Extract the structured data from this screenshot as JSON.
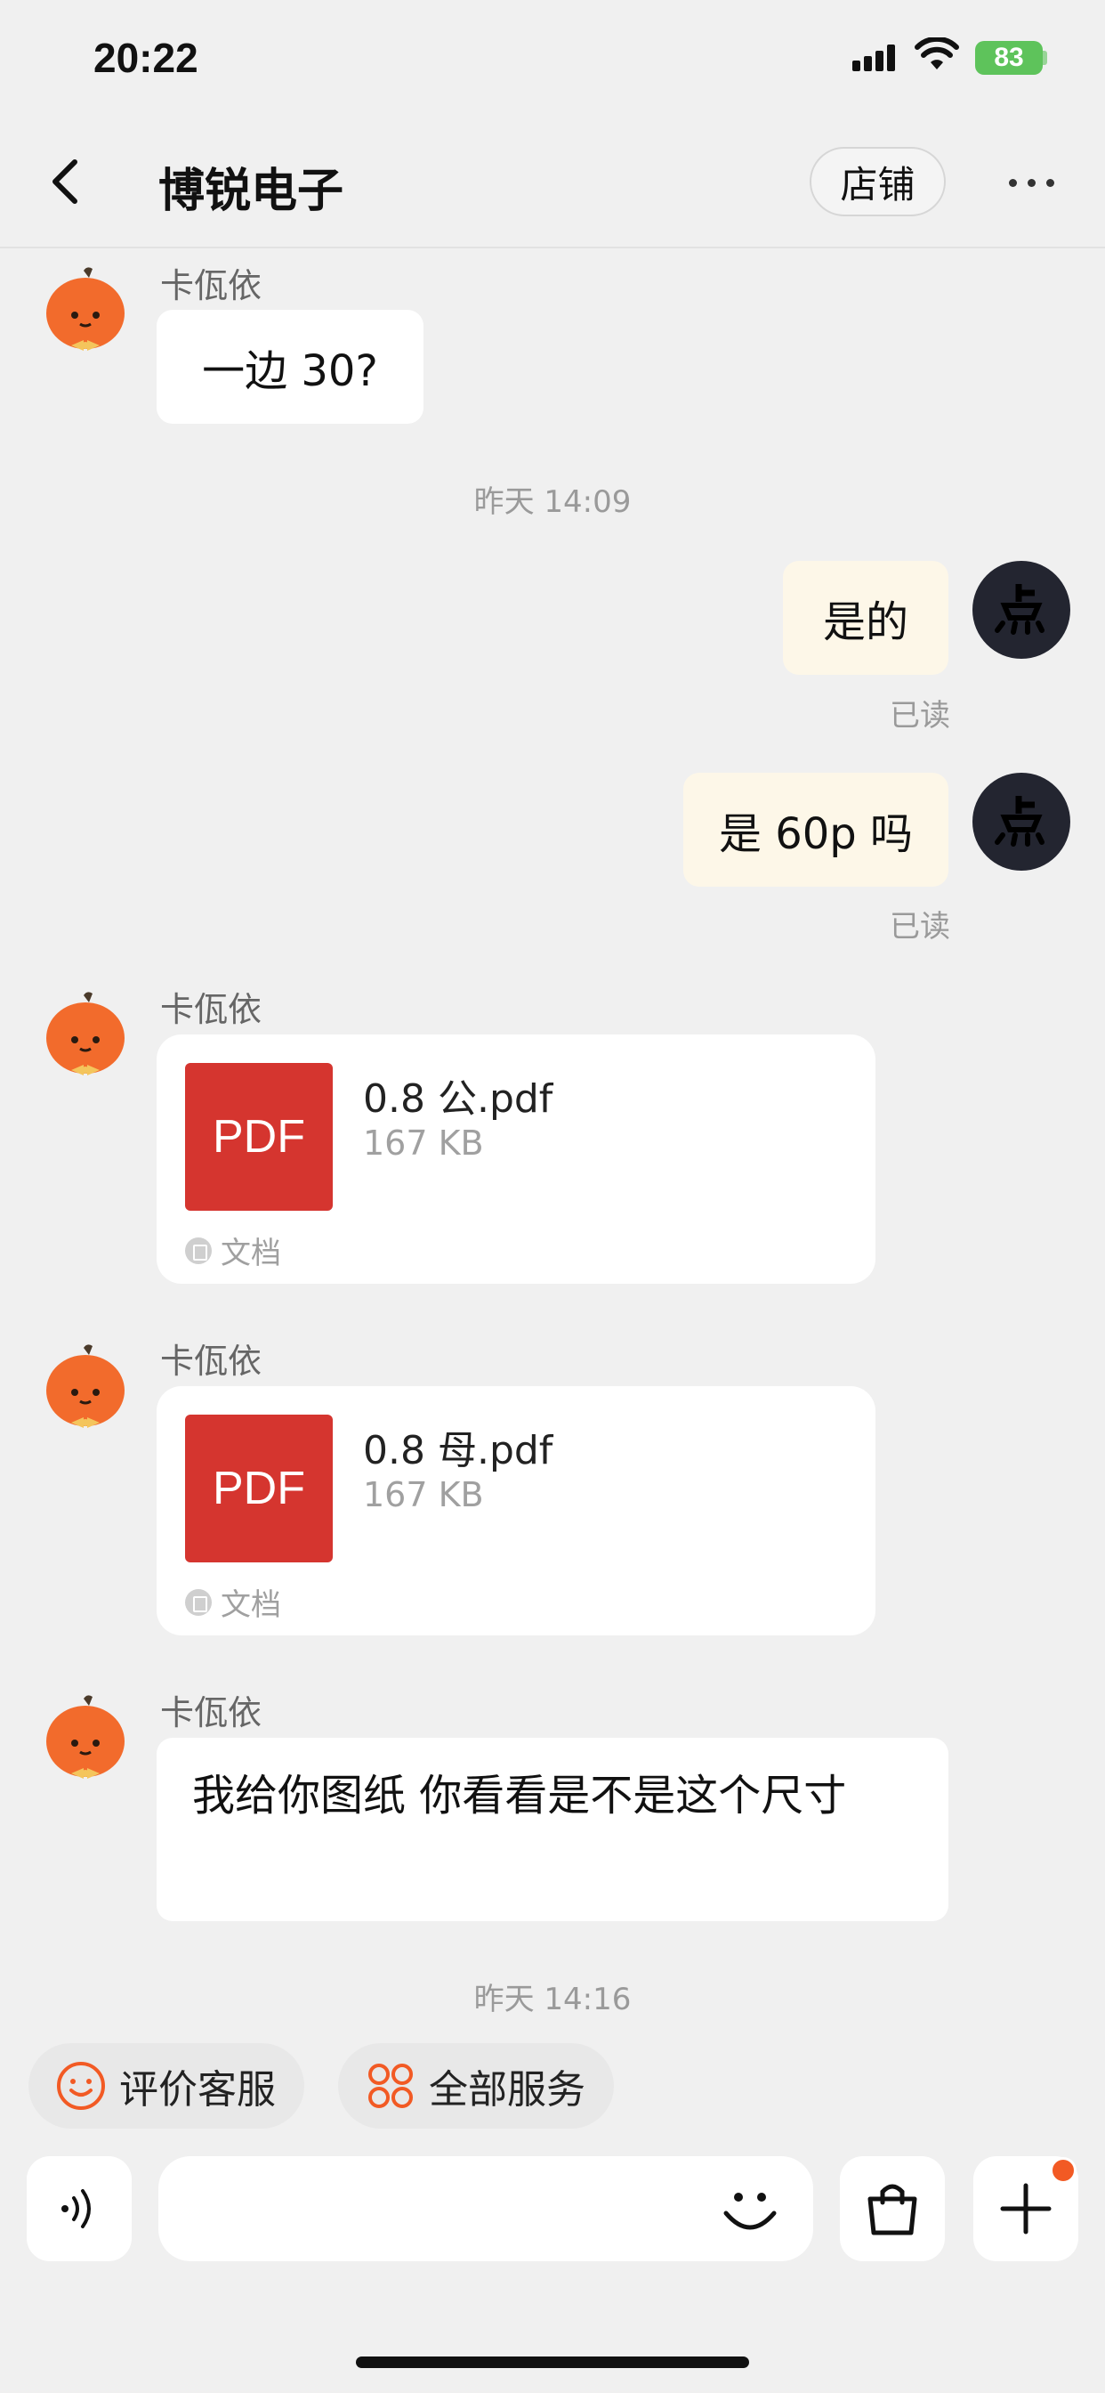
{
  "status_bar": {
    "time": "20:22",
    "battery": "83"
  },
  "nav": {
    "title": "博锐电子",
    "shop_label": "店铺"
  },
  "messages": {
    "m1": {
      "sender": "卡佤依",
      "text": "一边 30?"
    },
    "ts1": "昨天 14:09",
    "m2": {
      "text": "是的",
      "status": "已读"
    },
    "m3": {
      "text": "是 60p 吗",
      "status": "已读"
    },
    "m4": {
      "sender": "卡佤依",
      "file_icon": "PDF",
      "file_name": "0.8 公.pdf",
      "file_size": "167 KB",
      "tag": "文档"
    },
    "m5": {
      "sender": "卡佤依",
      "file_icon": "PDF",
      "file_name": "0.8 母.pdf",
      "file_size": "167 KB",
      "tag": "文档"
    },
    "m6": {
      "sender": "卡佤依",
      "text": "我给你图纸 你看看是不是这个尺寸"
    },
    "ts2": "昨天 14:16"
  },
  "quick_actions": {
    "rate": "评价客服",
    "all_services": "全部服务"
  },
  "input": {
    "placeholder": ""
  },
  "colors": {
    "accent": "#f25a24",
    "pdf": "#d5352f",
    "self_bubble": "#fdf7e8",
    "battery": "#5ec35b"
  },
  "icons": [
    "back-arrow-icon",
    "more-icon",
    "pumpkin-avatar-icon",
    "user-avatar-icon",
    "smiley-icon",
    "services-grid-icon",
    "voice-icon",
    "emoji-icon",
    "shopping-bag-icon",
    "plus-icon"
  ]
}
